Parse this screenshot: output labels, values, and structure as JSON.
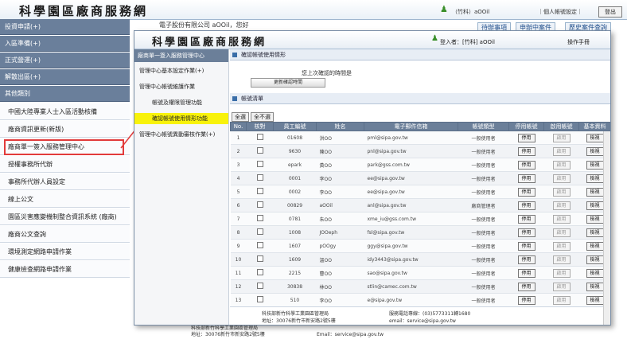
{
  "bg": {
    "title": "科學園區廠商服務網",
    "user": "（竹科）aOOil",
    "personal": "｜個人帳號設定｜",
    "logout": "登出",
    "company": "電子股份有限公司 aOOil，您好",
    "tabs": [
      "待辦事項",
      "申辦中案件",
      "歷史案件查詢"
    ],
    "sidebar": [
      "投資申請(+)",
      "入區準備(+)",
      "正式營運(+)",
      "解散出區(+)",
      "其他類別"
    ],
    "sub": [
      "中國大陸專業人士入區活動核備",
      "廠商資訊更新(新版)",
      "廠商單一簽入服務管理中心",
      "授權事務所代辦",
      "事務所代辦人員設定",
      "線上公文",
      "園區災害應變機制整合資訊系統 (廠商)",
      "廠商公文查詢",
      "環境測定網路申請作業",
      "健康檢查網路申請作業"
    ],
    "footer_line1": "科技部新竹科學工業園區管理局",
    "footer_line2": "地址：30076新竹市新安路2號5樓",
    "footer_email": "Email：service@sipa.gov.tw"
  },
  "win": {
    "title": "科學園區廠商服務網",
    "user": "登入者：[竹科] aOOil",
    "manual": "操作手冊",
    "sidebar_head": "廠商單一簽入服務管理中心",
    "items": [
      "管理中心基本設定作業(+)",
      "管理中心帳號維護作業",
      "帳號及權限管理功能",
      "確認帳號使用情形功能",
      "管理中心帳號異動審核作業(+)"
    ],
    "section1": "確認帳號使用情形",
    "last_time": "您上次確認的時間是",
    "update_btn": "更新確認時間",
    "section2": "帳號清單",
    "select_all": "全選",
    "deselect_all": "全不選",
    "headers": [
      "No.",
      "核對",
      "員工編號",
      "姓名",
      "電子郵件信箱",
      "帳號類型",
      "停用帳號",
      "啟用帳號",
      "基本資料"
    ],
    "rows": [
      {
        "no": "1",
        "id": "01608",
        "name": "洪OO",
        "email": "pml@sipa.gov.tw",
        "type": "一般使用者"
      },
      {
        "no": "2",
        "id": "9630",
        "name": "陳OO",
        "email": "pnl@sipa.gov.tw",
        "type": "一般使用者"
      },
      {
        "no": "3",
        "id": "epark",
        "name": "黃OO",
        "email": "park@gss.com.tw",
        "type": "一般使用者"
      },
      {
        "no": "4",
        "id": "0001",
        "name": "李OO",
        "email": "ee@sipa.gov.tw",
        "type": "一般使用者"
      },
      {
        "no": "5",
        "id": "0002",
        "name": "李OO",
        "email": "ee@sipa.gov.tw",
        "type": "一般使用者"
      },
      {
        "no": "6",
        "id": "00829",
        "name": "aOOil",
        "email": "anl@sipa.gov.tw",
        "type": "廠商管理者"
      },
      {
        "no": "7",
        "id": "0781",
        "name": "朱OO",
        "email": "xme_iu@gss.com.tw",
        "type": "一般使用者"
      },
      {
        "no": "8",
        "id": "1008",
        "name": "JOOeph",
        "email": "fsl@sipa.gov.tw",
        "type": "一般使用者"
      },
      {
        "no": "9",
        "id": "1607",
        "name": "pOOgy",
        "email": "ggy@sipa.gov.tw",
        "type": "一般使用者"
      },
      {
        "no": "10",
        "id": "1609",
        "name": "溫OO",
        "email": "idy3443@sipa.gov.tw",
        "type": "一般使用者"
      },
      {
        "no": "11",
        "id": "2215",
        "name": "曹OO",
        "email": "sao@sipa.gov.tw",
        "type": "一般使用者"
      },
      {
        "no": "12",
        "id": "30838",
        "name": "林OO",
        "email": "stlin@camec.com.tw",
        "type": "一般使用者"
      },
      {
        "no": "13",
        "id": "510",
        "name": "李OO",
        "email": "e@sipa.gov.tw",
        "type": "一般使用者"
      }
    ],
    "btn_disable": "停用",
    "btn_enable": "啟用",
    "btn_view": "檢視",
    "footer_left1": "科技部新竹科學工業園區管理局",
    "footer_left2": "地址：30076新竹市新安路2號5樓",
    "footer_right1": "服務電話專線：(03)5773311轉1680",
    "footer_right2": "email：service@sipa.gov.tw"
  }
}
